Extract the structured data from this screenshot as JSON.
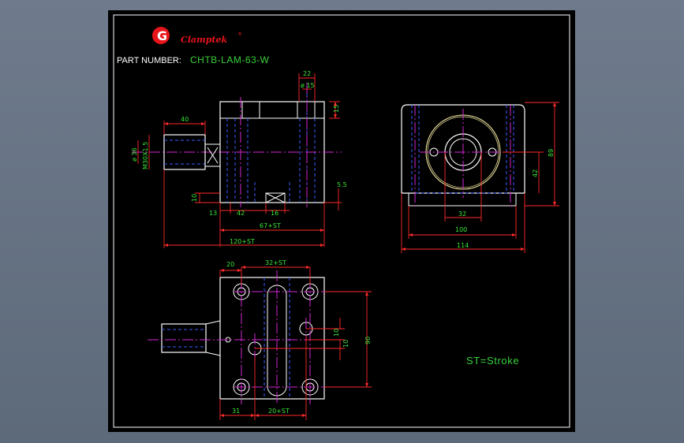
{
  "header": {
    "logo_letter": "G",
    "logo_text": "Clamptek",
    "logo_mark": "®",
    "part_label": "PART NUMBER:",
    "part_number": "CHTB-LAM-63-W"
  },
  "note": "ST=Stroke",
  "front_view": {
    "dim_22": "22",
    "dim_dia15": "ø 15",
    "dim_15": "15",
    "dim_40": "40",
    "dim_dia36": "ø 36",
    "dim_thread": "M30X1.5",
    "dim_10": "10",
    "dim_5_5": "5.5",
    "dim_13": "13",
    "dim_42": "42",
    "dim_16": "16",
    "dim_67st": "67+ST",
    "dim_120st": "120+ST"
  },
  "side_view": {
    "dim_89": "89",
    "dim_42": "42",
    "dim_32": "32",
    "dim_100": "100",
    "dim_114": "114"
  },
  "top_view": {
    "dim_20": "20",
    "dim_32st": "32+ST",
    "dim_10a": "10",
    "dim_10b": "10",
    "dim_90": "90",
    "dim_31": "31",
    "dim_20st": "20+ST"
  },
  "colors": {
    "sheet": "#000000",
    "body": "#ffffff",
    "hidden": "#3a5cff",
    "center": "#d226d2",
    "dimension": "#ff2a2a",
    "dim_text": "#39e639",
    "title_text": "#ffffff",
    "part_text": "#3ad13a",
    "logo_red": "#e8141b",
    "flange": "#f2e7a0"
  }
}
